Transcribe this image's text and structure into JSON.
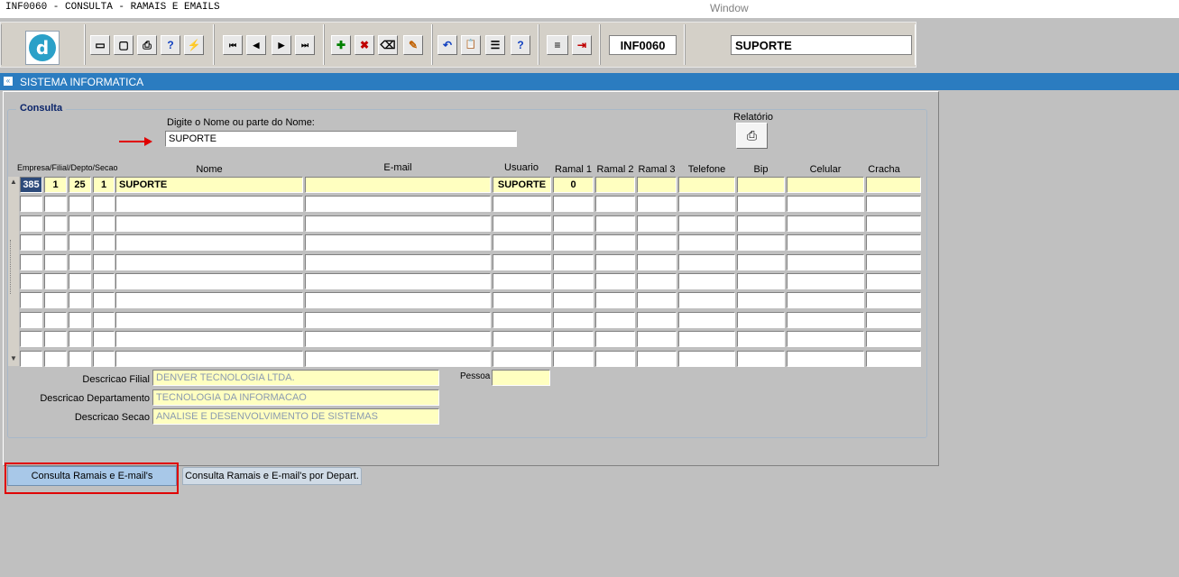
{
  "window": {
    "title": "INF0060 - CONSULTA - RAMAIS E EMAILS",
    "menu": "Window"
  },
  "toolbar": {
    "logo_glyph": "d",
    "form_code": "INF0060",
    "user": "SUPORTE",
    "buttons": [
      {
        "name": "save-icon",
        "glyph": "▭"
      },
      {
        "name": "screen-icon",
        "glyph": "▢"
      },
      {
        "name": "print-icon",
        "glyph": "⎙"
      },
      {
        "name": "query-icon",
        "glyph": "?"
      },
      {
        "name": "execute-query-icon",
        "glyph": "⚡"
      },
      {
        "name": "first-record-icon",
        "glyph": "⏮"
      },
      {
        "name": "previous-record-icon",
        "glyph": "◀"
      },
      {
        "name": "next-record-icon",
        "glyph": "▶"
      },
      {
        "name": "last-record-icon",
        "glyph": "⏭"
      },
      {
        "name": "insert-record-icon",
        "glyph": "✚"
      },
      {
        "name": "delete-record-icon",
        "glyph": "✖"
      },
      {
        "name": "clear-record-icon",
        "glyph": "⌫"
      },
      {
        "name": "edit-icon",
        "glyph": "✎"
      },
      {
        "name": "undo-icon",
        "glyph": "↶"
      },
      {
        "name": "clipboard-icon",
        "glyph": "📋"
      },
      {
        "name": "list-values-icon",
        "glyph": "☰"
      },
      {
        "name": "help-icon",
        "glyph": "?"
      },
      {
        "name": "menu-icon",
        "glyph": "≡"
      },
      {
        "name": "exit-icon",
        "glyph": "⇥"
      }
    ]
  },
  "section": {
    "title": "SISTEMA INFORMATICA"
  },
  "consulta": {
    "frame_title": "Consulta",
    "search_label": "Digite o Nome ou parte do Nome:",
    "search_value": "SUPORTE",
    "relatorio_label": "Relatório"
  },
  "table": {
    "headers": {
      "org": "Empresa/Filial/Depto/Secao",
      "nome": "Nome",
      "email": "E-mail",
      "usuario": "Usuario",
      "ramal1": "Ramal 1",
      "ramal2": "Ramal 2",
      "ramal3": "Ramal 3",
      "telefone": "Telefone",
      "bip": "Bip",
      "celular": "Celular",
      "cracha": "Cracha"
    },
    "rows": [
      {
        "empresa": "385",
        "filial": "1",
        "depto": "25",
        "secao": "1",
        "nome": "SUPORTE",
        "email": "",
        "usuario": "SUPORTE",
        "ramal1": "0",
        "ramal2": "",
        "ramal3": "",
        "telefone": "",
        "bip": "",
        "celular": "",
        "cracha": ""
      },
      {
        "empresa": "",
        "filial": "",
        "depto": "",
        "secao": "",
        "nome": "",
        "email": "",
        "usuario": "",
        "ramal1": "",
        "ramal2": "",
        "ramal3": "",
        "telefone": "",
        "bip": "",
        "celular": "",
        "cracha": ""
      },
      {
        "empresa": "",
        "filial": "",
        "depto": "",
        "secao": "",
        "nome": "",
        "email": "",
        "usuario": "",
        "ramal1": "",
        "ramal2": "",
        "ramal3": "",
        "telefone": "",
        "bip": "",
        "celular": "",
        "cracha": ""
      },
      {
        "empresa": "",
        "filial": "",
        "depto": "",
        "secao": "",
        "nome": "",
        "email": "",
        "usuario": "",
        "ramal1": "",
        "ramal2": "",
        "ramal3": "",
        "telefone": "",
        "bip": "",
        "celular": "",
        "cracha": ""
      },
      {
        "empresa": "",
        "filial": "",
        "depto": "",
        "secao": "",
        "nome": "",
        "email": "",
        "usuario": "",
        "ramal1": "",
        "ramal2": "",
        "ramal3": "",
        "telefone": "",
        "bip": "",
        "celular": "",
        "cracha": ""
      },
      {
        "empresa": "",
        "filial": "",
        "depto": "",
        "secao": "",
        "nome": "",
        "email": "",
        "usuario": "",
        "ramal1": "",
        "ramal2": "",
        "ramal3": "",
        "telefone": "",
        "bip": "",
        "celular": "",
        "cracha": ""
      },
      {
        "empresa": "",
        "filial": "",
        "depto": "",
        "secao": "",
        "nome": "",
        "email": "",
        "usuario": "",
        "ramal1": "",
        "ramal2": "",
        "ramal3": "",
        "telefone": "",
        "bip": "",
        "celular": "",
        "cracha": ""
      },
      {
        "empresa": "",
        "filial": "",
        "depto": "",
        "secao": "",
        "nome": "",
        "email": "",
        "usuario": "",
        "ramal1": "",
        "ramal2": "",
        "ramal3": "",
        "telefone": "",
        "bip": "",
        "celular": "",
        "cracha": ""
      },
      {
        "empresa": "",
        "filial": "",
        "depto": "",
        "secao": "",
        "nome": "",
        "email": "",
        "usuario": "",
        "ramal1": "",
        "ramal2": "",
        "ramal3": "",
        "telefone": "",
        "bip": "",
        "celular": "",
        "cracha": ""
      },
      {
        "empresa": "",
        "filial": "",
        "depto": "",
        "secao": "",
        "nome": "",
        "email": "",
        "usuario": "",
        "ramal1": "",
        "ramal2": "",
        "ramal3": "",
        "telefone": "",
        "bip": "",
        "celular": "",
        "cracha": ""
      }
    ]
  },
  "details": {
    "filial_label": "Descricao Filial",
    "filial_value": "DENVER TECNOLOGIA LTDA.",
    "departamento_label": "Descricao Departamento",
    "departamento_value": "TECNOLOGIA DA INFORMACAO",
    "secao_label": "Descricao Secao",
    "secao_value": "ANALISE E DESENVOLVIMENTO DE SISTEMAS",
    "pessoa_label": "Pessoa",
    "pessoa_value": ""
  },
  "tabs": [
    {
      "label": "Consulta Ramais e E-mail's",
      "active": true
    },
    {
      "label": "Consulta Ramais e E-mail's por Depart.",
      "active": false
    }
  ],
  "colors": {
    "accent": "#2b7cc0",
    "field_yellow": "#ffffc0",
    "highlight_red": "#e00000"
  }
}
